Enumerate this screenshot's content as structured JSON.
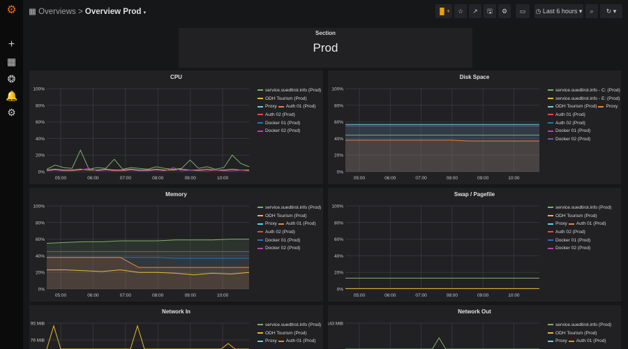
{
  "topbar": {
    "breadcrumb_parent": "Overviews",
    "separator": ">",
    "dashboard_title": "Overview Prod",
    "time_range": "Last 6 hours"
  },
  "sidebar": {
    "items": [
      "grafana-logo",
      "plus-icon",
      "dashboards-icon",
      "explore-icon",
      "bell-icon",
      "gear-icon"
    ]
  },
  "section": {
    "title": "Section",
    "value": "Prod"
  },
  "colors": {
    "green": "#7eb26d",
    "yellow": "#eab839",
    "lightblue": "#6ed0e0",
    "orange": "#ef843c",
    "red": "#e24d42",
    "blue": "#1f78c1",
    "purple": "#ba43a9",
    "violet": "#705da0"
  },
  "panels": [
    {
      "title": "CPU",
      "yticks": [
        "100%",
        "80%",
        "60%",
        "40%",
        "20%",
        "0%"
      ],
      "ymax": 100,
      "xticks": [
        "05:00",
        "06:00",
        "07:00",
        "08:00",
        "09:00",
        "10:00"
      ],
      "legend": [
        [
          [
            "service.suedtirol.info (Prod)",
            "#7eb26d"
          ]
        ],
        [
          [
            "ODH Tourism (Prod)",
            "#eab839"
          ]
        ],
        [
          [
            "Proxy",
            "#6ed0e0"
          ],
          [
            "Auth 01 (Prod)",
            "#ef843c"
          ]
        ],
        [
          [
            "Auth 02 (Prod)",
            "#e24d42"
          ]
        ],
        [
          [
            "Docker 01 (Prod)",
            "#1f78c1"
          ]
        ],
        [
          [
            "Docker 02 (Prod)",
            "#ba43a9"
          ]
        ]
      ],
      "series": [
        {
          "color": "#7eb26d",
          "values": [
            3,
            8,
            5,
            4,
            26,
            3,
            5,
            4,
            15,
            3,
            5,
            4,
            3,
            6,
            4,
            3,
            4,
            14,
            4,
            6,
            3,
            5,
            20,
            10,
            6
          ]
        },
        {
          "color": "#eab839",
          "values": [
            2,
            3,
            2,
            2,
            3,
            2,
            2,
            3,
            2,
            2,
            3,
            2,
            2,
            3,
            2,
            2,
            3,
            2,
            2,
            3,
            2,
            2,
            3,
            2,
            2
          ]
        },
        {
          "color": "#ba43a9",
          "values": [
            1,
            2,
            1,
            1,
            2,
            4,
            1,
            2,
            1,
            1,
            2,
            1,
            1,
            2,
            1,
            5,
            1,
            2,
            1,
            1,
            2,
            1,
            1,
            2,
            1
          ]
        }
      ]
    },
    {
      "title": "Disk Space",
      "yticks": [
        "100%",
        "80%",
        "60%",
        "40%",
        "20%",
        "0%"
      ],
      "ymax": 100,
      "xticks": [
        "05:00",
        "06:00",
        "07:00",
        "08:00",
        "09:00",
        "10:00"
      ],
      "legend": [
        [
          [
            "service.suedtirol.info - C: (Prod)",
            "#7eb26d"
          ]
        ],
        [
          [
            "service.suedtirol.info - E: (Prod)",
            "#eab839"
          ]
        ],
        [
          [
            "ODH Tourism (Prod)",
            "#6ed0e0"
          ],
          [
            "Proxy",
            "#ef843c"
          ]
        ],
        [
          [
            "Auth 01 (Prod)",
            "#e24d42"
          ]
        ],
        [
          [
            "Auth 02 (Prod)",
            "#1f78c1"
          ]
        ],
        [
          [
            "Docker 01 (Prod)",
            "#ba43a9"
          ]
        ],
        [
          [
            "Docker 02 (Prod)",
            "#705da0"
          ]
        ]
      ],
      "series": [
        {
          "color": "#6ed0e0",
          "values": [
            57,
            57,
            57,
            57,
            57,
            57,
            57,
            57,
            57,
            57,
            57,
            57
          ],
          "fill": true
        },
        {
          "color": "#705da0",
          "values": [
            55,
            55,
            55,
            55,
            55,
            55,
            55,
            55,
            55,
            55,
            55,
            55
          ],
          "fill": true
        },
        {
          "color": "#7eb26d",
          "values": [
            44,
            44,
            44,
            44,
            44,
            44,
            44,
            44,
            44,
            44,
            44,
            44
          ]
        },
        {
          "color": "#ef843c",
          "values": [
            38,
            38,
            38,
            38,
            38,
            38,
            38,
            37,
            37,
            37,
            37,
            37
          ],
          "fill": true
        }
      ]
    },
    {
      "title": "Memory",
      "yticks": [
        "100%",
        "80%",
        "60%",
        "40%",
        "20%",
        "0%"
      ],
      "ymax": 100,
      "xticks": [
        "05:00",
        "06:00",
        "07:00",
        "08:00",
        "09:00",
        "10:00"
      ],
      "legend": [
        [
          [
            "service.suedtirol.info (Prod)",
            "#7eb26d"
          ]
        ],
        [
          [
            "ODH Tourism (Prod)",
            "#eab839"
          ]
        ],
        [
          [
            "Proxy",
            "#6ed0e0"
          ],
          [
            "Auth 01 (Prod)",
            "#ef843c"
          ]
        ],
        [
          [
            "Auth 02 (Prod)",
            "#e24d42"
          ]
        ],
        [
          [
            "Docker 01 (Prod)",
            "#1f78c1"
          ]
        ],
        [
          [
            "Docker 02 (Prod)",
            "#ba43a9"
          ]
        ]
      ],
      "series": [
        {
          "color": "#7eb26d",
          "values": [
            55,
            56,
            57,
            57,
            58,
            58,
            58,
            59,
            59,
            59,
            60,
            60
          ],
          "fill": true
        },
        {
          "color": "#705da0",
          "values": [
            45,
            45,
            45,
            45,
            45,
            45,
            45,
            45,
            45,
            45,
            45,
            45
          ],
          "fill": true
        },
        {
          "color": "#1f78c1",
          "values": [
            38,
            38,
            38,
            38,
            38,
            38,
            38,
            37,
            37,
            37,
            37,
            37
          ]
        },
        {
          "color": "#ef843c",
          "values": [
            38,
            38,
            38,
            38,
            38,
            26,
            26,
            26,
            26,
            26,
            26,
            26
          ],
          "fill": true
        },
        {
          "color": "#eab839",
          "values": [
            23,
            23,
            22,
            21,
            23,
            20,
            20,
            19,
            17,
            19,
            18,
            20
          ]
        }
      ]
    },
    {
      "title": "Swap / Pagefile",
      "yticks": [
        "100%",
        "80%",
        "60%",
        "40%",
        "20%",
        "0%"
      ],
      "ymax": 100,
      "xticks": [
        "05:00",
        "06:00",
        "07:00",
        "08:00",
        "09:00",
        "10:00"
      ],
      "legend": [
        [
          [
            "service.suedtirol.info (Prod)",
            "#7eb26d"
          ]
        ],
        [
          [
            "ODH Tourism (Prod)",
            "#eab839"
          ]
        ],
        [
          [
            "Proxy",
            "#6ed0e0"
          ],
          [
            "Auth 01 (Prod)",
            "#ef843c"
          ]
        ],
        [
          [
            "Auth 02 (Prod)",
            "#e24d42"
          ]
        ],
        [
          [
            "Docker 01 (Prod)",
            "#1f78c1"
          ]
        ],
        [
          [
            "Docker 02 (Prod)",
            "#ba43a9"
          ]
        ]
      ],
      "series": [
        {
          "color": "#7eb26d",
          "values": [
            13,
            13,
            13,
            13,
            13,
            13,
            13,
            13,
            13,
            13,
            13,
            13
          ]
        },
        {
          "color": "#eab839",
          "values": [
            0.5,
            0.5,
            0.5,
            0.5,
            0.5,
            0.5,
            0.5,
            0.5,
            0.5,
            0.5,
            0.5,
            0.5
          ]
        }
      ]
    },
    {
      "title": "Network In",
      "yticks": [
        "95 MiB",
        "76 MiB"
      ],
      "ymax": 95,
      "xticks": [],
      "legend": [
        [
          [
            "service.suedtirol.info (Prod)",
            "#7eb26d"
          ]
        ],
        [
          [
            "ODH Tourism (Prod)",
            "#eab839"
          ]
        ],
        [
          [
            "Proxy",
            "#6ed0e0"
          ],
          [
            "Auth 01 (Prod)",
            "#ef843c"
          ]
        ]
      ],
      "series": [
        {
          "color": "#eab839",
          "values": [
            0,
            92,
            0,
            0,
            0,
            0,
            0,
            0,
            0,
            0,
            0,
            0,
            0,
            92,
            0,
            0,
            0,
            0,
            0,
            0,
            0,
            0,
            0,
            0,
            0,
            0,
            72,
            0,
            0,
            0
          ]
        }
      ]
    },
    {
      "title": "Network Out",
      "yticks": [
        "143 MiB"
      ],
      "ymax": 143,
      "xticks": [],
      "legend": [
        [
          [
            "service.suedtirol.info (Prod)",
            "#7eb26d"
          ]
        ],
        [
          [
            "ODH Tourism (Prod)",
            "#eab839"
          ]
        ],
        [
          [
            "Proxy",
            "#6ed0e0"
          ],
          [
            "Auth 01 (Prod)",
            "#ef843c"
          ]
        ]
      ],
      "series": [
        {
          "color": "#7eb26d",
          "values": [
            0,
            0,
            0,
            0,
            0,
            0,
            0,
            0,
            0,
            0,
            0,
            0,
            0,
            0,
            118,
            0,
            0,
            0,
            0,
            0,
            0,
            0,
            0,
            0,
            0,
            0,
            0,
            0,
            0,
            0
          ]
        }
      ]
    }
  ]
}
